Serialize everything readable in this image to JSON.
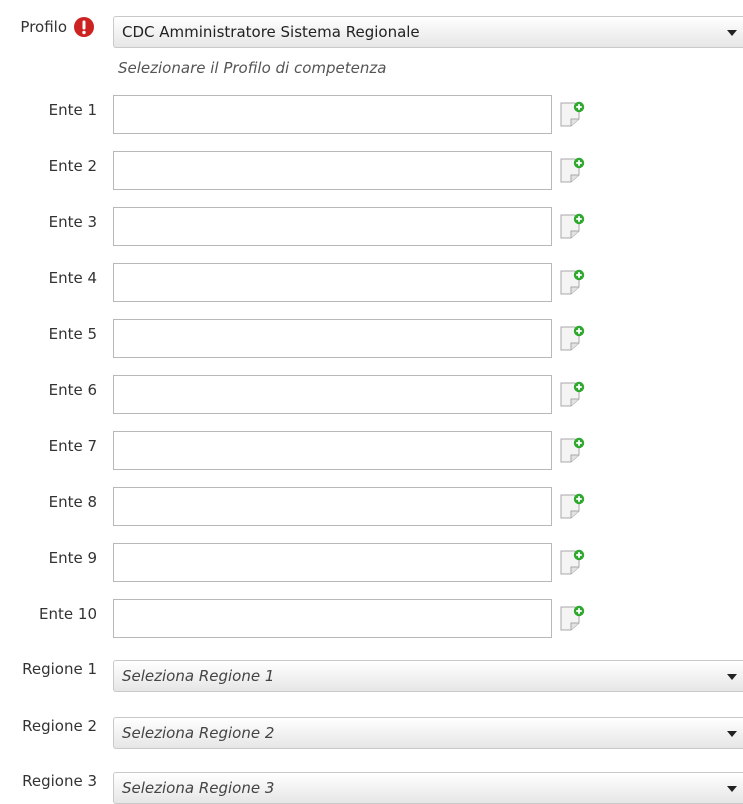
{
  "profilo": {
    "label": "Profilo",
    "selected": "CDC Amministratore Sistema Regionale",
    "hint": "Selezionare il Profilo di competenza"
  },
  "enti": [
    {
      "label": "Ente 1",
      "value": ""
    },
    {
      "label": "Ente 2",
      "value": ""
    },
    {
      "label": "Ente 3",
      "value": ""
    },
    {
      "label": "Ente 4",
      "value": ""
    },
    {
      "label": "Ente 5",
      "value": ""
    },
    {
      "label": "Ente 6",
      "value": ""
    },
    {
      "label": "Ente 7",
      "value": ""
    },
    {
      "label": "Ente 8",
      "value": ""
    },
    {
      "label": "Ente 9",
      "value": ""
    },
    {
      "label": "Ente 10",
      "value": ""
    }
  ],
  "regioni": [
    {
      "label": "Regione 1",
      "selected": "Seleziona Regione 1"
    },
    {
      "label": "Regione 2",
      "selected": "Seleziona Regione 2"
    },
    {
      "label": "Regione 3",
      "selected": "Seleziona Regione 3"
    }
  ],
  "icons": {
    "required": "exclamation-circle-icon",
    "add": "document-add-icon"
  },
  "colors": {
    "required_red": "#cc2222",
    "add_green": "#2ea82e"
  }
}
